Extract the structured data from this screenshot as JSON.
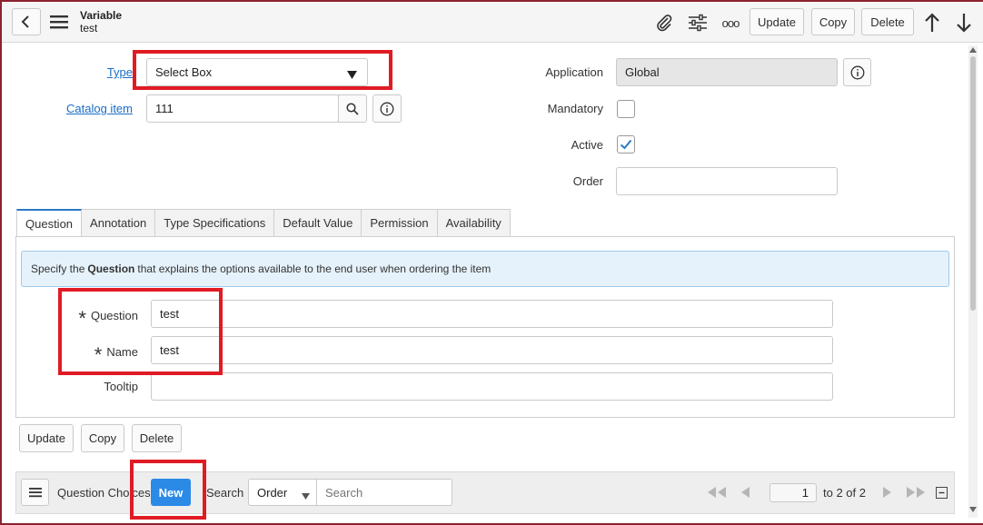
{
  "header": {
    "title": "Variable",
    "subtitle": "test",
    "update_label": "Update",
    "copy_label": "Copy",
    "delete_label": "Delete",
    "more_label": "ooo"
  },
  "form": {
    "type_label": "Type",
    "type_value": "Select Box",
    "catalog_item_label": "Catalog item",
    "catalog_item_value": "111",
    "application_label": "Application",
    "application_value": "Global",
    "mandatory_label": "Mandatory",
    "mandatory_checked": false,
    "active_label": "Active",
    "active_checked": true,
    "order_label": "Order",
    "order_value": ""
  },
  "tabs": [
    {
      "label": "Question",
      "active": true
    },
    {
      "label": "Annotation",
      "active": false
    },
    {
      "label": "Type Specifications",
      "active": false
    },
    {
      "label": "Default Value",
      "active": false
    },
    {
      "label": "Permission",
      "active": false
    },
    {
      "label": "Availability",
      "active": false
    }
  ],
  "question_tab": {
    "info_prefix": "Specify the",
    "info_bold": "Question",
    "info_suffix": "that explains the options available to the end user when ordering the item",
    "question_label": "Question",
    "question_value": "test",
    "name_label": "Name",
    "name_value": "test",
    "tooltip_label": "Tooltip",
    "tooltip_value": ""
  },
  "form_buttons": {
    "update_label": "Update",
    "copy_label": "Copy",
    "delete_label": "Delete"
  },
  "related_list": {
    "title": "Question Choices",
    "new_label": "New",
    "search_label": "Search",
    "search_field_value": "Order",
    "search_placeholder": "Search",
    "page_value": "1",
    "page_range": "to 2 of 2"
  },
  "colors": {
    "accent": "#2b8ae6",
    "annotation_red": "#e01b24",
    "link": "#1a6ec7"
  }
}
